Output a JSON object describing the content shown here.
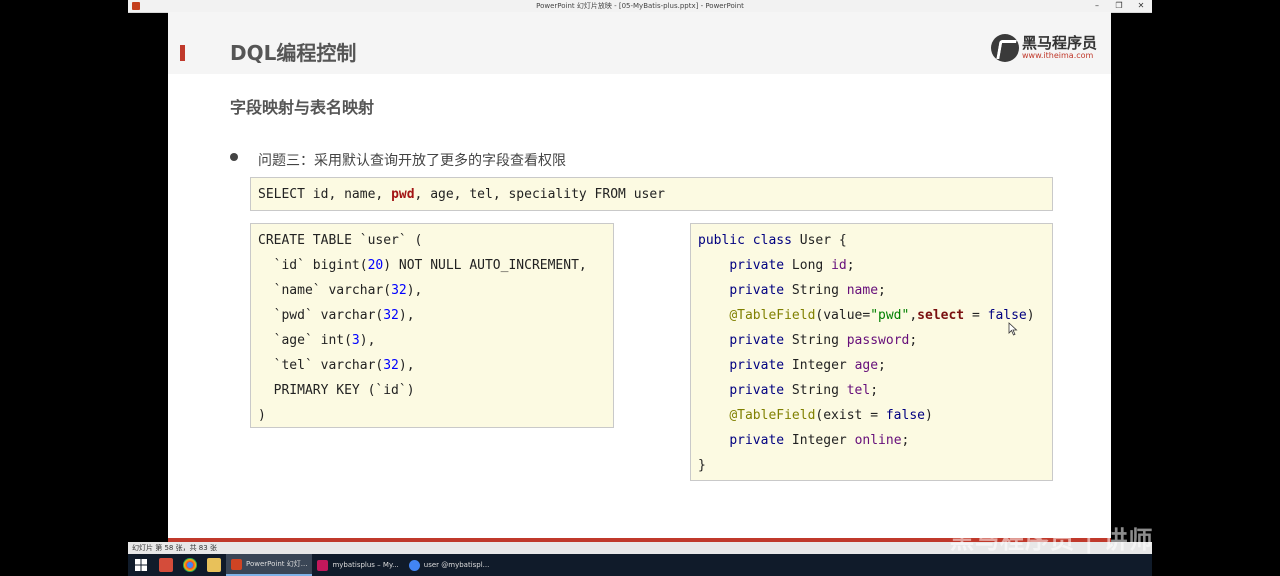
{
  "window": {
    "title": "PowerPoint 幻灯片放映 - [05-MyBatis-plus.pptx] - PowerPoint",
    "controls": [
      "–",
      "❐",
      "✕"
    ]
  },
  "slide": {
    "title": "DQL编程控制",
    "logo_cn": "黑马程序员",
    "logo_url": "www.itheima.com",
    "subtitle": "字段映射与表名映射",
    "bullet": "问题三：采用默认查询开放了更多的字段查看权限"
  },
  "sql": {
    "before": "SELECT id, name, ",
    "highlight": "pwd",
    "after": ", age, tel, speciality FROM user"
  },
  "create_table": {
    "line1": "CREATE TABLE `user` (",
    "l2a": "  `id` bigint(",
    "l2n": "20",
    "l2b": ") NOT NULL AUTO_INCREMENT,",
    "l3a": "  `name` varchar(",
    "l3n": "32",
    "l3b": "),",
    "l4a": "  `pwd` varchar(",
    "l4n": "32",
    "l4b": "),",
    "l5a": "  `age` int(",
    "l5n": "3",
    "l5b": "),",
    "l6a": "  `tel` varchar(",
    "l6n": "32",
    "l6b": "),",
    "line7": "  PRIMARY KEY (`id`)",
    "line8": ")"
  },
  "java": {
    "public": "public",
    "class": "class",
    "classname": " User {",
    "private": "private",
    "t_long": " Long ",
    "f_id": "id",
    "t_string": " String ",
    "f_name": "name",
    "ann": "@TableField",
    "ann1_a": "(value=",
    "ann1_str": "\"pwd\"",
    "ann1_comma": ",",
    "ann1_select": "select",
    "ann1_eq": " = ",
    "ann1_false": "false",
    "ann1_close": ")",
    "f_password": "password",
    "t_integer": " Integer ",
    "f_age": "age",
    "f_tel": "tel",
    "ann2_a": "(exist = ",
    "ann2_false": "false",
    "ann2_close": ")",
    "f_online": "online",
    "semi": ";",
    "close": "}"
  },
  "status": {
    "text": "幻灯片 第 58 张，共 83 张"
  },
  "taskbar": {
    "items": [
      "PowerPoint 幻灯...",
      "mybatisplus – My...",
      "user @mybatispl..."
    ]
  },
  "watermark": "黑马程序员 | 讲师",
  "colors": {
    "accent": "#c0392b",
    "code_bg": "#fcfae2"
  }
}
